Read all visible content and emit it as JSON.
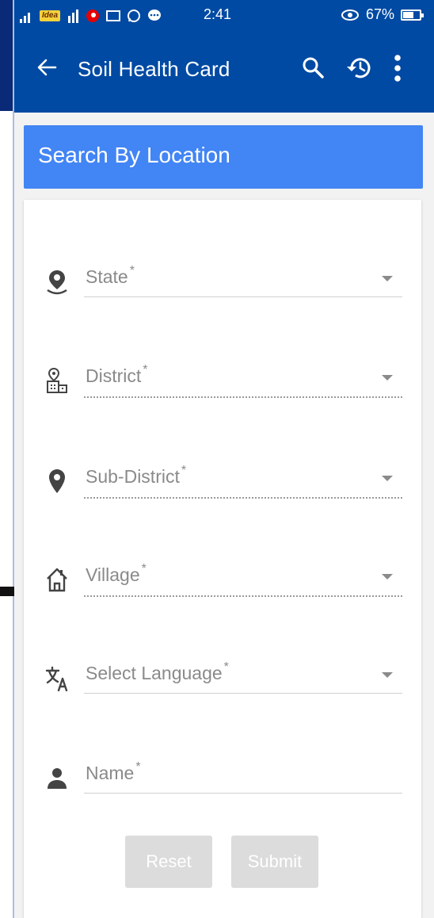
{
  "status_bar": {
    "carrier": "Idea",
    "time": "2:41",
    "battery": "67%",
    "battery_level": 0.67
  },
  "app_bar": {
    "title": "Soil Health Card",
    "back_icon": "arrow-back-icon",
    "search_icon": "search-icon",
    "history_icon": "history-icon",
    "more_icon": "more-vert-icon"
  },
  "section": {
    "title": "Search By Location"
  },
  "form": {
    "fields": [
      {
        "label": "State",
        "required": "*",
        "icon": "person-pin-icon"
      },
      {
        "label": "District",
        "required": "*",
        "icon": "district-building-icon"
      },
      {
        "label": "Sub-District",
        "required": "*",
        "icon": "location-pin-icon"
      },
      {
        "label": "Village",
        "required": "*",
        "icon": "home-icon"
      },
      {
        "label": "Select Language",
        "required": "*",
        "icon": "translate-icon"
      },
      {
        "label": "Name",
        "required": "*",
        "icon": "person-icon"
      }
    ],
    "reset_label": "Reset",
    "submit_label": "Submit"
  },
  "colors": {
    "app_bar": "#004aa3",
    "section_header": "#4285f4",
    "button_disabled": "#dcdcdc"
  }
}
